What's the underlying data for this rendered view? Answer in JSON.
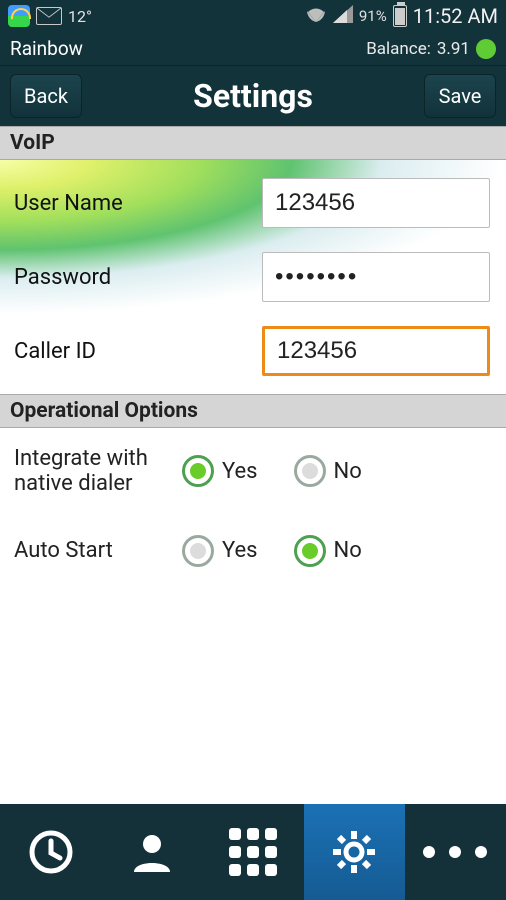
{
  "statusbar": {
    "temperature": "12°",
    "battery_pct": "91%",
    "time": "11:52 AM"
  },
  "app": {
    "name": "Rainbow",
    "balance_label": "Balance:",
    "balance_value": "3.91"
  },
  "titlebar": {
    "back": "Back",
    "title": "Settings",
    "save": "Save"
  },
  "voip": {
    "section": "VoIP",
    "username_label": "User Name",
    "username_value": "123456",
    "password_label": "Password",
    "password_value": "••••••••",
    "callerid_label": "Caller ID",
    "callerid_value": "123456"
  },
  "operational": {
    "section": "Operational Options",
    "integrate_label": "Integrate with native dialer",
    "autostart_label": "Auto Start",
    "yes": "Yes",
    "no": "No",
    "integrate_selected": "yes",
    "autostart_selected": "no"
  }
}
